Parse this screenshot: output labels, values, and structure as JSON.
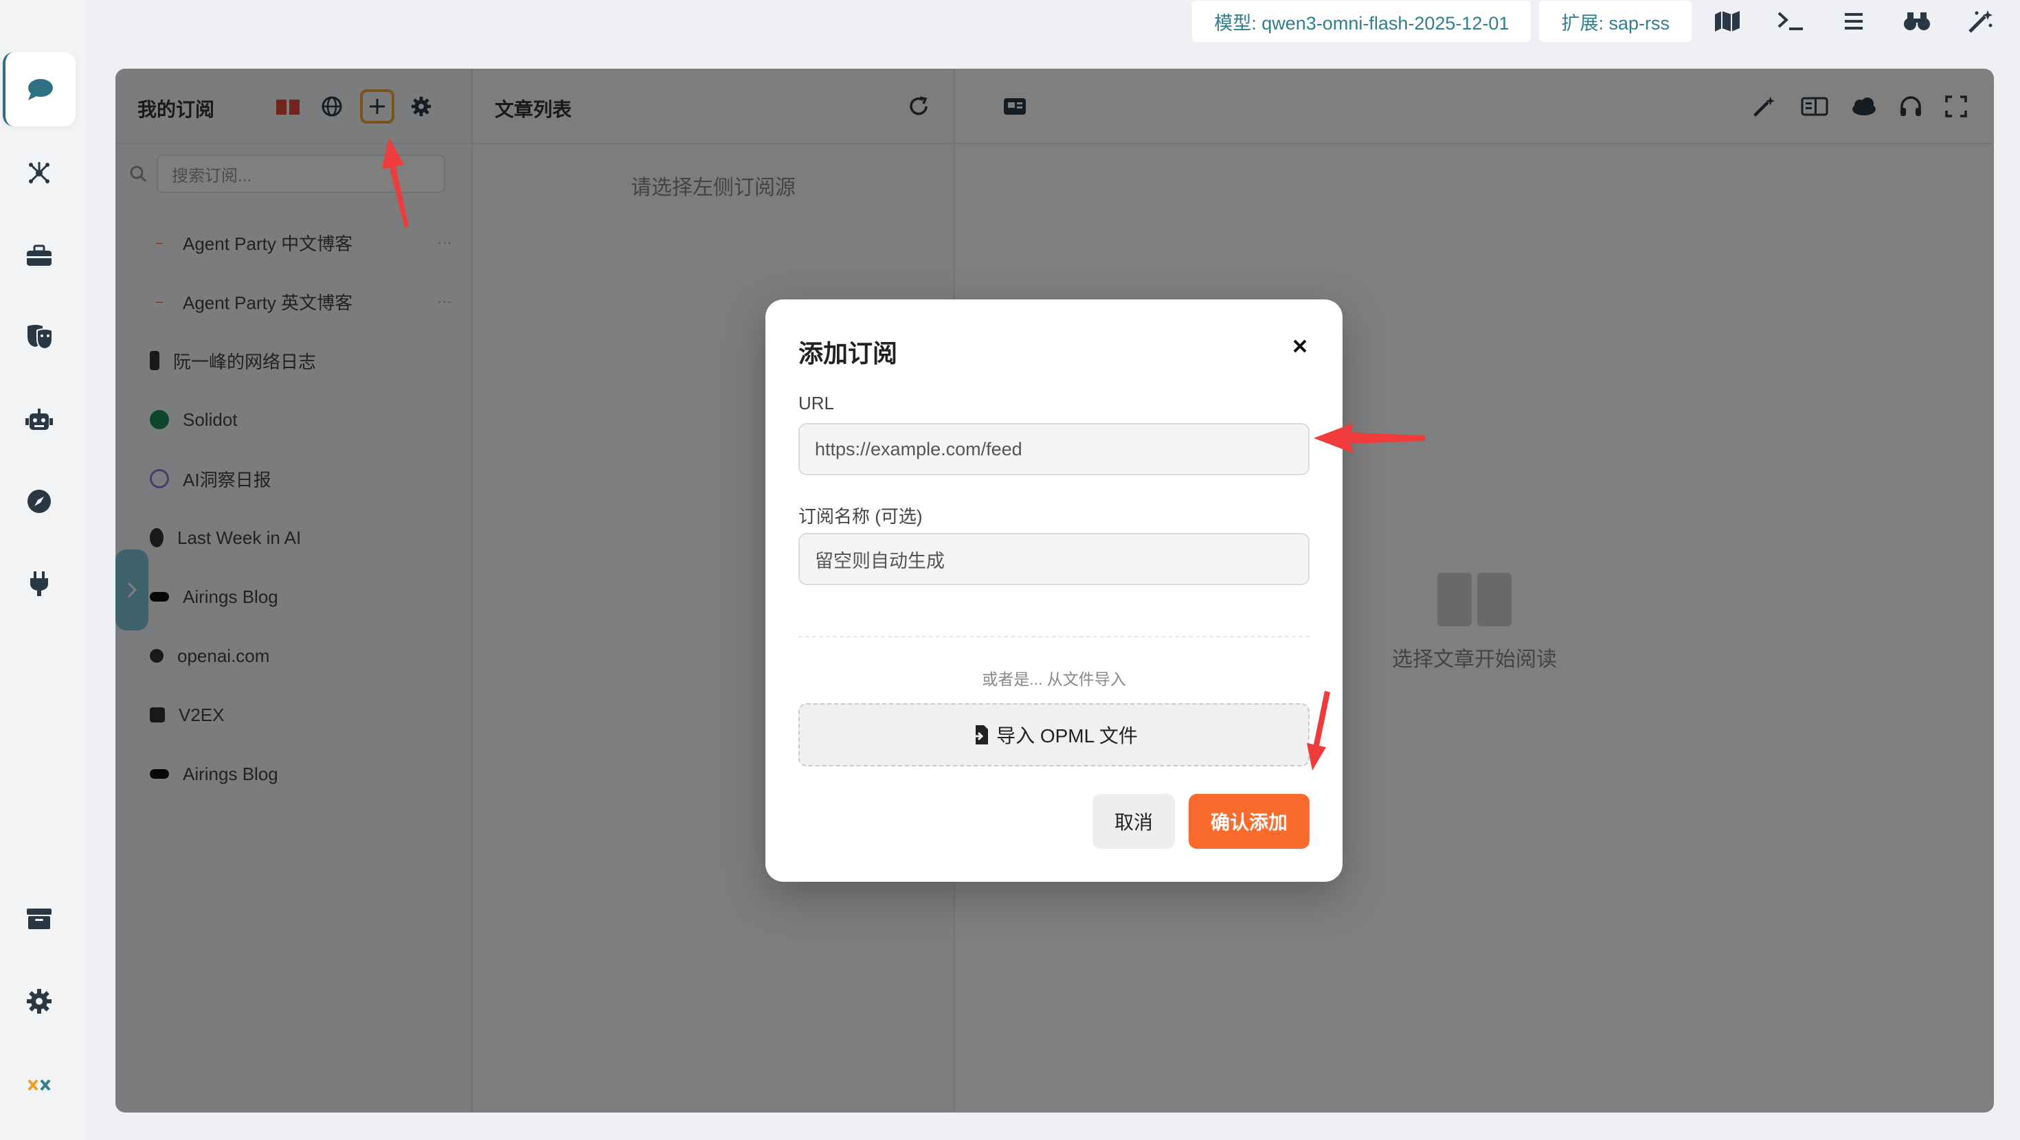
{
  "window": {
    "controls": [
      "close",
      "minimize",
      "maximize"
    ]
  },
  "topbar": {
    "model_label": "模型: qwen3-omni-flash-2025-12-01",
    "extension_label": "扩展: sap-rss",
    "icons": [
      "map-icon",
      "terminal-icon",
      "menu-icon",
      "binoculars-icon",
      "magic-wand-icon"
    ]
  },
  "sidebar": {
    "items": [
      {
        "icon": "chat-bubble-icon",
        "active": true
      },
      {
        "icon": "network-icon"
      },
      {
        "icon": "toolbox-icon"
      },
      {
        "icon": "theater-masks-icon"
      },
      {
        "icon": "robot-icon"
      },
      {
        "icon": "compass-icon"
      },
      {
        "icon": "plug-icon"
      }
    ],
    "bottom_items": [
      {
        "icon": "archive-icon"
      },
      {
        "icon": "gear-icon"
      },
      {
        "icon": "app-logo-icon"
      }
    ]
  },
  "subscriptions": {
    "title": "我的订阅",
    "search_placeholder": "搜索订阅...",
    "feeds": [
      {
        "name": "Agent Party 中文博客",
        "more": "···"
      },
      {
        "name": "Agent Party 英文博客",
        "more": "···"
      },
      {
        "name": "阮一峰的网络日志"
      },
      {
        "name": "Solidot"
      },
      {
        "name": "AI洞察日报"
      },
      {
        "name": "Last Week in AI"
      },
      {
        "name": "Airings Blog"
      },
      {
        "name": "openai.com"
      },
      {
        "name": "V2EX"
      },
      {
        "name": "Airings Blog"
      }
    ]
  },
  "articles": {
    "title": "文章列表",
    "empty_text": "请选择左侧订阅源"
  },
  "reader": {
    "empty_text": "选择文章开始阅读"
  },
  "modal": {
    "title": "添加订阅",
    "url_label": "URL",
    "url_placeholder": "https://example.com/feed",
    "name_label": "订阅名称 (可选)",
    "name_placeholder": "留空则自动生成",
    "or_text": "或者是... 从文件导入",
    "import_label": "导入 OPML 文件",
    "cancel_label": "取消",
    "confirm_label": "确认添加"
  },
  "colors": {
    "accent": "#f96a2c",
    "highlight": "#f6a33a",
    "annotation": "#ef3b3b",
    "teal": "#2f7f8f"
  }
}
